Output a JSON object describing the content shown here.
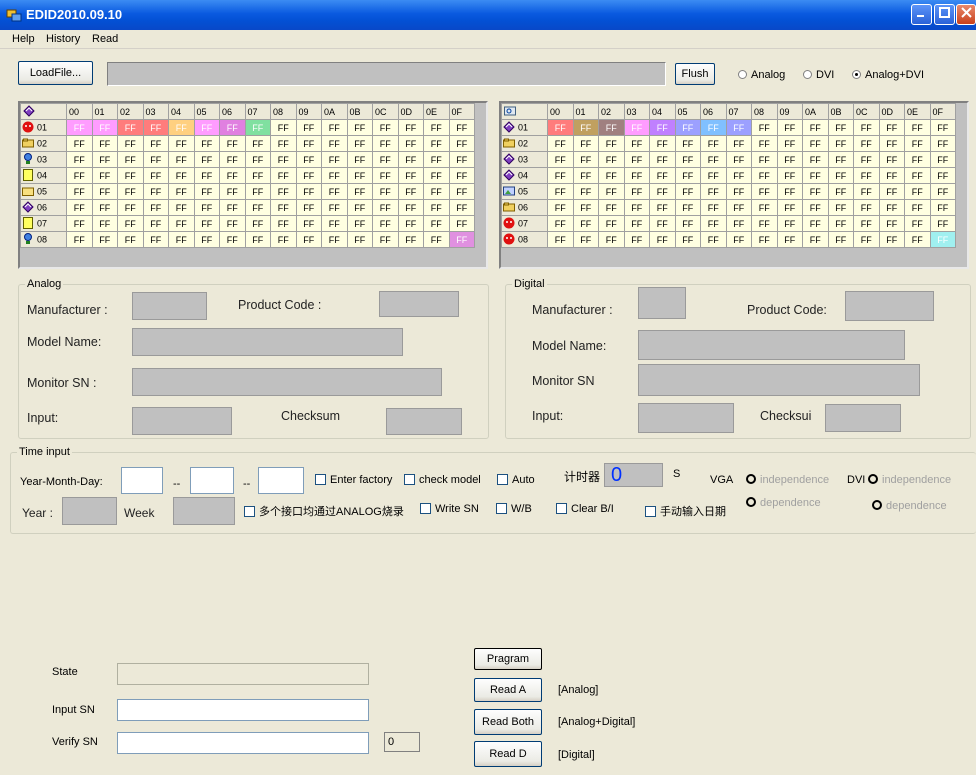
{
  "window": {
    "title": "EDID2010.09.10"
  },
  "menu": [
    {
      "label": "Help"
    },
    {
      "label": "History"
    },
    {
      "label": "Read"
    }
  ],
  "toolbar": {
    "loadfile_label": "LoadFile...",
    "flush_label": "Flush",
    "mode_options": [
      "Analog",
      "DVI",
      "Analog+DVI"
    ],
    "mode_selected": "Analog+DVI"
  },
  "grid_columns": [
    "00",
    "01",
    "02",
    "03",
    "04",
    "05",
    "06",
    "07",
    "08",
    "09",
    "0A",
    "0B",
    "0C",
    "0D",
    "0E",
    "0F"
  ],
  "grid_left": {
    "header_icon": "book-icon",
    "rows": [
      {
        "label": "01",
        "icon": "red-face-icon",
        "cells": [
          "FF",
          "FF",
          "FF",
          "FF",
          "FF",
          "FF",
          "FF",
          "FF",
          "FF",
          "FF",
          "FF",
          "FF",
          "FF",
          "FF",
          "FF",
          "FF"
        ],
        "colors": [
          "#ff9cff",
          "#ff9cff",
          "#ff7c7c",
          "#ff7c7c",
          "#ffd080",
          "#ff9cff",
          "#e080e0",
          "#80e0a0",
          "",
          "",
          "",
          "",
          "",
          "",
          "",
          ""
        ]
      },
      {
        "label": "02",
        "icon": "folder-open-icon",
        "cells": [
          "FF",
          "FF",
          "FF",
          "FF",
          "FF",
          "FF",
          "FF",
          "FF",
          "FF",
          "FF",
          "FF",
          "FF",
          "FF",
          "FF",
          "FF",
          "FF"
        ],
        "colors": []
      },
      {
        "label": "03",
        "icon": "globe-person-icon",
        "cells": [
          "FF",
          "FF",
          "FF",
          "FF",
          "FF",
          "FF",
          "FF",
          "FF",
          "FF",
          "FF",
          "FF",
          "FF",
          "FF",
          "FF",
          "FF",
          "FF"
        ],
        "colors": []
      },
      {
        "label": "04",
        "icon": "note-icon",
        "cells": [
          "FF",
          "FF",
          "FF",
          "FF",
          "FF",
          "FF",
          "FF",
          "FF",
          "FF",
          "FF",
          "FF",
          "FF",
          "FF",
          "FF",
          "FF",
          "FF"
        ],
        "colors": []
      },
      {
        "label": "05",
        "icon": "folder-icon",
        "cells": [
          "FF",
          "FF",
          "FF",
          "FF",
          "FF",
          "FF",
          "FF",
          "FF",
          "FF",
          "FF",
          "FF",
          "FF",
          "FF",
          "FF",
          "FF",
          "FF"
        ],
        "colors": []
      },
      {
        "label": "06",
        "icon": "book-icon",
        "cells": [
          "FF",
          "FF",
          "FF",
          "FF",
          "FF",
          "FF",
          "FF",
          "FF",
          "FF",
          "FF",
          "FF",
          "FF",
          "FF",
          "FF",
          "FF",
          "FF"
        ],
        "colors": []
      },
      {
        "label": "07",
        "icon": "note-icon",
        "cells": [
          "FF",
          "FF",
          "FF",
          "FF",
          "FF",
          "FF",
          "FF",
          "FF",
          "FF",
          "FF",
          "FF",
          "FF",
          "FF",
          "FF",
          "FF",
          "FF"
        ],
        "colors": []
      },
      {
        "label": "08",
        "icon": "globe-person-icon",
        "cells": [
          "FF",
          "FF",
          "FF",
          "FF",
          "FF",
          "FF",
          "FF",
          "FF",
          "FF",
          "FF",
          "FF",
          "FF",
          "FF",
          "FF",
          "FF",
          "FF"
        ],
        "colors": [
          "",
          "",
          "",
          "",
          "",
          "",
          "",
          "",
          "",
          "",
          "",
          "",
          "",
          "",
          "",
          "#e090e0"
        ]
      }
    ]
  },
  "grid_right": {
    "header_icon": "search-card-icon",
    "rows": [
      {
        "label": "01",
        "icon": "book-icon",
        "cells": [
          "FF",
          "FF",
          "FF",
          "FF",
          "FF",
          "FF",
          "FF",
          "FF",
          "FF",
          "FF",
          "FF",
          "FF",
          "FF",
          "FF",
          "FF",
          "FF"
        ],
        "colors": [
          "#ff7c7c",
          "#c0a060",
          "#a08080",
          "#ff9cff",
          "#c080ff",
          "#9ca0ff",
          "#80c0ff",
          "#9ca0ff",
          "",
          "",
          "",
          "",
          "",
          "",
          "",
          ""
        ]
      },
      {
        "label": "02",
        "icon": "folder-open-icon",
        "cells": [
          "FF",
          "FF",
          "FF",
          "FF",
          "FF",
          "FF",
          "FF",
          "FF",
          "FF",
          "FF",
          "FF",
          "FF",
          "FF",
          "FF",
          "FF",
          "FF"
        ],
        "colors": []
      },
      {
        "label": "03",
        "icon": "book-icon",
        "cells": [
          "FF",
          "FF",
          "FF",
          "FF",
          "FF",
          "FF",
          "FF",
          "FF",
          "FF",
          "FF",
          "FF",
          "FF",
          "FF",
          "FF",
          "FF",
          "FF"
        ],
        "colors": []
      },
      {
        "label": "04",
        "icon": "book-icon",
        "cells": [
          "FF",
          "FF",
          "FF",
          "FF",
          "FF",
          "FF",
          "FF",
          "FF",
          "FF",
          "FF",
          "FF",
          "FF",
          "FF",
          "FF",
          "FF",
          "FF"
        ],
        "colors": []
      },
      {
        "label": "05",
        "icon": "image-icon",
        "cells": [
          "FF",
          "FF",
          "FF",
          "FF",
          "FF",
          "FF",
          "FF",
          "FF",
          "FF",
          "FF",
          "FF",
          "FF",
          "FF",
          "FF",
          "FF",
          "FF"
        ],
        "colors": []
      },
      {
        "label": "06",
        "icon": "folder-open-icon",
        "cells": [
          "FF",
          "FF",
          "FF",
          "FF",
          "FF",
          "FF",
          "FF",
          "FF",
          "FF",
          "FF",
          "FF",
          "FF",
          "FF",
          "FF",
          "FF",
          "FF"
        ],
        "colors": []
      },
      {
        "label": "07",
        "icon": "red-face-icon",
        "cells": [
          "FF",
          "FF",
          "FF",
          "FF",
          "FF",
          "FF",
          "FF",
          "FF",
          "FF",
          "FF",
          "FF",
          "FF",
          "FF",
          "FF",
          "FF",
          "FF"
        ],
        "colors": []
      },
      {
        "label": "08",
        "icon": "red-face-icon",
        "cells": [
          "FF",
          "FF",
          "FF",
          "FF",
          "FF",
          "FF",
          "FF",
          "FF",
          "FF",
          "FF",
          "FF",
          "FF",
          "FF",
          "FF",
          "FF",
          "FF"
        ],
        "colors": [
          "",
          "",
          "",
          "",
          "",
          "",
          "",
          "",
          "",
          "",
          "",
          "",
          "",
          "",
          "",
          "#a0f0f0"
        ]
      }
    ]
  },
  "analog": {
    "group_title": "Analog",
    "manufacturer_label": "Manufacturer :",
    "product_code_label": "Product Code :",
    "model_name_label": "Model Name:",
    "monitor_sn_label": "Monitor SN :",
    "input_label": "Input:",
    "checksum_label": "Checksum"
  },
  "digital": {
    "group_title": "Digital",
    "manufacturer_label": "Manufacturer :",
    "product_code_label": "Product Code:",
    "model_name_label": "Model Name:",
    "monitor_sn_label": "Monitor SN",
    "input_label": "Input:",
    "checksum_label": "Checksui"
  },
  "time_input": {
    "group_title": "Time input",
    "ymd_label": "Year-Month-Day:",
    "sep": "--",
    "year_label": "Year :",
    "week_label": "Week",
    "enter_factory": "Enter factory",
    "check_model": "check model",
    "auto": "Auto",
    "timer_label": "计时器",
    "timer_value": "0",
    "timer_unit": "S",
    "vga_label": "VGA",
    "dvi_label": "DVI",
    "independence": "independence",
    "dependence": "dependence",
    "multi_port": "多个接口均通过ANALOG烧录",
    "write_sn": "Write SN",
    "wb": "W/B",
    "clear_bi": "Clear B/I",
    "manual_date": "手动输入日期"
  },
  "bottom": {
    "state_label": "State",
    "input_sn_label": "Input SN",
    "verify_sn_label": "Verify SN",
    "verify_count": "0",
    "program_label": "Pragram",
    "read_a_label": "Read A",
    "read_both_label": "Read Both",
    "read_d_label": "Read D",
    "read_a_desc": "[Analog]",
    "read_both_desc": "[Analog+Digital]",
    "read_d_desc": "[Digital]"
  },
  "colors": {
    "title_bar": "#0a5ae0",
    "cell_bg": "#ffffe1",
    "timer_blue": "#0030ff"
  }
}
